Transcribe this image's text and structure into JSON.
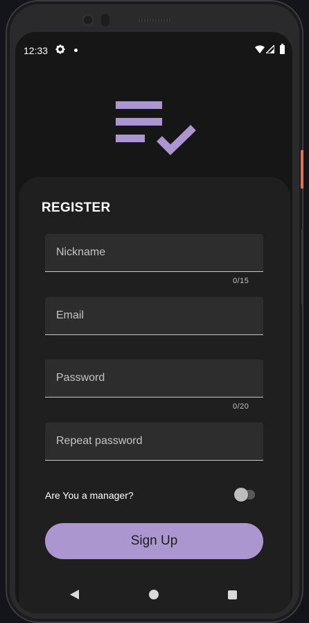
{
  "status_bar": {
    "time": "12:33",
    "icons": [
      "gear-icon",
      "dot-icon",
      "wifi-icon",
      "signal-icon",
      "battery-icon"
    ]
  },
  "logo": {
    "icon": "checklist-icon",
    "color": "#ab96cf"
  },
  "form": {
    "title": "REGISTER",
    "fields": {
      "nickname": {
        "placeholder": "Nickname",
        "value": "",
        "counter": "0/15"
      },
      "email": {
        "placeholder": "Email",
        "value": ""
      },
      "password": {
        "placeholder": "Password",
        "value": "",
        "counter": "0/20"
      },
      "repeat_password": {
        "placeholder": "Repeat password",
        "value": ""
      }
    },
    "manager_toggle": {
      "label": "Are You a manager?",
      "checked": false
    },
    "submit_label": "Sign Up"
  },
  "navigation": {
    "icons": [
      "back-icon",
      "home-icon",
      "recents-icon"
    ]
  },
  "colors": {
    "accent": "#ab96cf",
    "background": "#161616",
    "card": "#1f1f1f",
    "field": "#2d2d2d"
  }
}
